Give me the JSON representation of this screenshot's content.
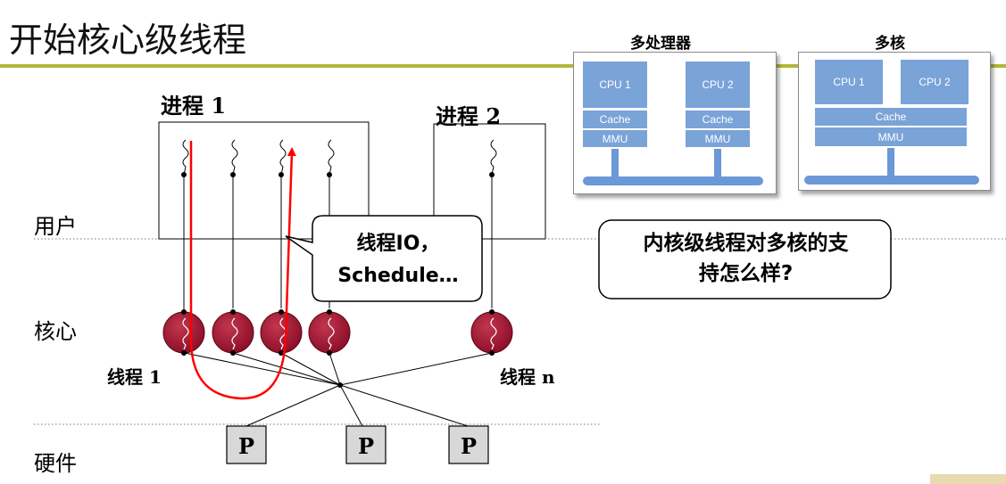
{
  "page": {
    "title": "开始核心级线程"
  },
  "levels": {
    "user": "用户",
    "kernel": "核心",
    "hardware": "硬件"
  },
  "processes": {
    "p1": "进程 1",
    "p2": "进程 2"
  },
  "threads": {
    "first": "线程 1",
    "last": "线程 n"
  },
  "processor_label": "P",
  "callout_io": {
    "line1": "线程IO，",
    "line2": "Schedule…"
  },
  "callout_question": {
    "line1": "内核级线程对多核的支",
    "line2": "持怎么样?"
  },
  "multiprocessor": {
    "heading": "多处理器",
    "cpu1": "CPU 1",
    "cpu2": "CPU 2",
    "cache": "Cache",
    "mmu": "MMU"
  },
  "multicore": {
    "heading": "多核",
    "cpu1": "CPU 1",
    "cpu2": "CPU 2",
    "cache": "Cache",
    "mmu": "MMU"
  },
  "colors": {
    "accent_rule": "#b3b73a",
    "kernel_thread": "#9e0f2e",
    "path_arrow": "#ff0000",
    "block_blue": "#7aa3d8"
  }
}
